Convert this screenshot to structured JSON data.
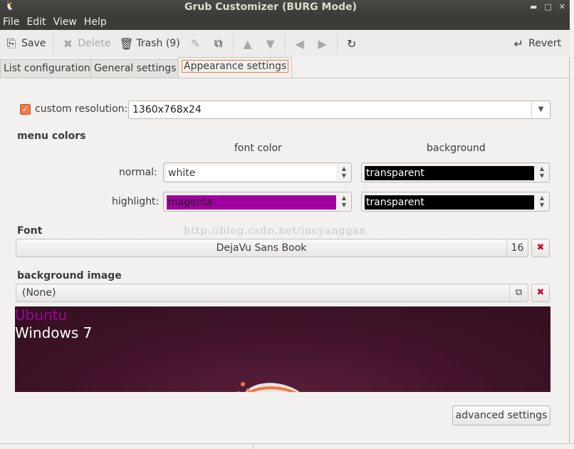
{
  "window": {
    "title": "Grub Customizer (BURG Mode)"
  },
  "menu": [
    "File",
    "Edit",
    "View",
    "Help"
  ],
  "toolbar": {
    "save": "Save",
    "delete": "Delete",
    "trash": "Trash (9)",
    "revert": "Revert"
  },
  "tabs": [
    "List configuration",
    "General settings",
    "Appearance settings"
  ],
  "resolution": {
    "label": "custom resolution:",
    "value": "1360x768x24",
    "checked": true
  },
  "menu_colors": {
    "heading": "menu colors",
    "col_font": "font color",
    "col_background": "background",
    "normal_label": "normal:",
    "highlight_label": "highlight:",
    "normal_font": "white",
    "normal_bg": "transparent",
    "highlight_font": "magenta",
    "highlight_bg": "transparent"
  },
  "font": {
    "heading": "Font",
    "name": "DejaVu Sans Book",
    "size": "16"
  },
  "background_image": {
    "heading": "background image",
    "value": "(None)"
  },
  "preview": {
    "entry1": "Ubuntu",
    "entry2": "Windows 7"
  },
  "advanced_button": "advanced settings",
  "watermark": "http://blog.csdn.net/incyanggan",
  "colors": {
    "accent": "#f07746",
    "highlight_swatch": "#a000a0",
    "black_swatch": "#000000",
    "preview_bg": "#3f1228"
  }
}
